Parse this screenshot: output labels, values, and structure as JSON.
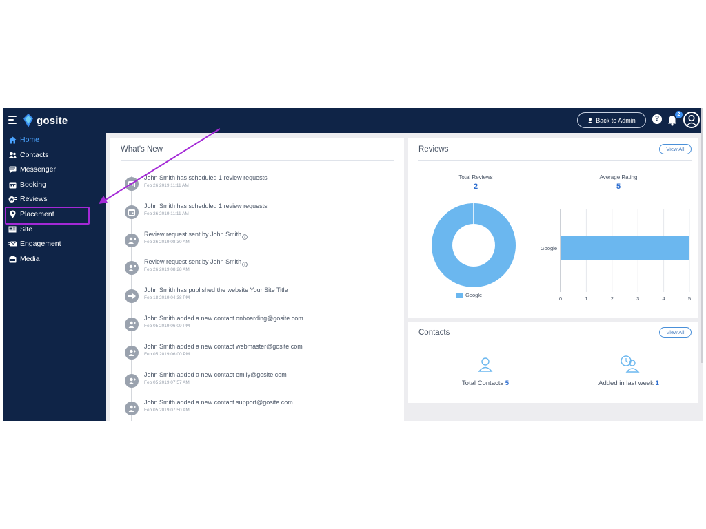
{
  "brand": {
    "name": "gosite"
  },
  "header": {
    "back_to_admin": "Back to Admin",
    "help": "?",
    "notification_count": "2"
  },
  "sidebar": {
    "items": [
      {
        "label": "Home",
        "icon": "home-icon",
        "active": true
      },
      {
        "label": "Contacts",
        "icon": "contacts-icon"
      },
      {
        "label": "Messenger",
        "icon": "messenger-icon"
      },
      {
        "label": "Booking",
        "icon": "booking-icon"
      },
      {
        "label": "Reviews",
        "icon": "reviews-icon"
      },
      {
        "label": "Placement",
        "icon": "location-pin-icon",
        "highlighted": true
      },
      {
        "label": "Site",
        "icon": "site-icon"
      },
      {
        "label": "Engagement",
        "icon": "engagement-icon"
      },
      {
        "label": "Media",
        "icon": "media-icon"
      }
    ]
  },
  "whats_new": {
    "title": "What's New",
    "activities": [
      {
        "text": "John Smith has scheduled 1 review requests",
        "time": "Feb 26 2019 11:11 AM",
        "icon": "calendar-icon"
      },
      {
        "text": "John Smith has scheduled 1 review requests",
        "time": "Feb 26 2019 11:11 AM",
        "icon": "calendar-icon"
      },
      {
        "text": "Review request sent by John Smith",
        "time": "Feb 26 2019 08:30 AM",
        "icon": "review-request-icon",
        "info": true
      },
      {
        "text": "Review request sent by John Smith",
        "time": "Feb 26 2019 08:28 AM",
        "icon": "review-request-icon",
        "info": true
      },
      {
        "text": "John Smith has published the website Your Site Title",
        "time": "Feb 18 2019 04:38 PM",
        "icon": "publish-icon"
      },
      {
        "text": "John Smith added a new contact onboarding@gosite.com",
        "time": "Feb 05 2019 06:09 PM",
        "icon": "add-contact-icon"
      },
      {
        "text": "John Smith added a new contact webmaster@gosite.com",
        "time": "Feb 05 2019 06:00 PM",
        "icon": "add-contact-icon"
      },
      {
        "text": "John Smith added a new contact emily@gosite.com",
        "time": "Feb 05 2019 07:57 AM",
        "icon": "add-contact-icon"
      },
      {
        "text": "John Smith added a new contact support@gosite.com",
        "time": "Feb 05 2019 07:50 AM",
        "icon": "add-contact-icon"
      }
    ]
  },
  "reviews": {
    "title": "Reviews",
    "view_all": "View All",
    "total_label": "Total Reviews",
    "total_value": "2",
    "avg_label": "Average Rating",
    "avg_value": "5",
    "legend_label": "Google"
  },
  "chart_data": [
    {
      "type": "pie",
      "categories": [
        "Google"
      ],
      "values": [
        2
      ],
      "legend": "bottom",
      "color": "#6bb7ef"
    },
    {
      "type": "bar",
      "orientation": "horizontal",
      "categories": [
        "Google"
      ],
      "values": [
        5
      ],
      "xlim": [
        0,
        5
      ],
      "xticks": [
        "0",
        "1",
        "2",
        "3",
        "4",
        "5"
      ],
      "grid": true,
      "color": "#6bb7ef"
    }
  ],
  "contacts": {
    "title": "Contacts",
    "view_all": "View All",
    "total_label": "Total Contacts",
    "total_value": "5",
    "week_label": "Added in last week",
    "week_value": "1"
  },
  "colors": {
    "navy": "#0f2447",
    "accent": "#4aa3ff",
    "chart": "#6bb7ef",
    "annotation": "#a429d6"
  }
}
